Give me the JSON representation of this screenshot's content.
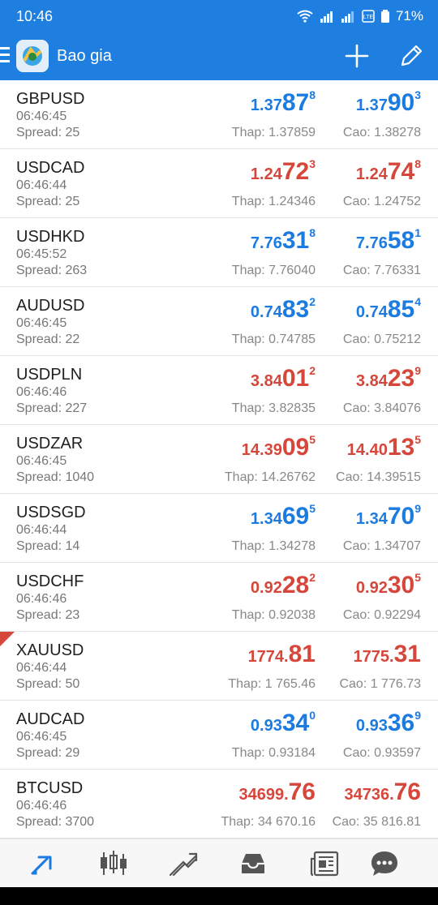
{
  "status": {
    "time": "10:46",
    "battery": "71%"
  },
  "app": {
    "title": "Bao gia",
    "accent": "#1f7fe0",
    "up_color": "#1b7be0",
    "down_color": "#d6463a"
  },
  "quotes": [
    {
      "symbol": "GBPUSD",
      "time": "06:46:45",
      "spread": "Spread: 25",
      "color": "blue",
      "bid": [
        "1.37",
        "87",
        "8"
      ],
      "ask": [
        "1.37",
        "90",
        "3"
      ],
      "low": "Thap: 1.37859",
      "high": "Cao: 1.38278"
    },
    {
      "symbol": "USDCAD",
      "time": "06:46:44",
      "spread": "Spread: 25",
      "color": "red",
      "bid": [
        "1.24",
        "72",
        "3"
      ],
      "ask": [
        "1.24",
        "74",
        "8"
      ],
      "low": "Thap: 1.24346",
      "high": "Cao: 1.24752"
    },
    {
      "symbol": "USDHKD",
      "time": "06:45:52",
      "spread": "Spread: 263",
      "color": "blue",
      "bid": [
        "7.76",
        "31",
        "8"
      ],
      "ask": [
        "7.76",
        "58",
        "1"
      ],
      "low": "Thap: 7.76040",
      "high": "Cao: 7.76331"
    },
    {
      "symbol": "AUDUSD",
      "time": "06:46:45",
      "spread": "Spread: 22",
      "color": "blue",
      "bid": [
        "0.74",
        "83",
        "2"
      ],
      "ask": [
        "0.74",
        "85",
        "4"
      ],
      "low": "Thap: 0.74785",
      "high": "Cao: 0.75212"
    },
    {
      "symbol": "USDPLN",
      "time": "06:46:46",
      "spread": "Spread: 227",
      "color": "red",
      "bid": [
        "3.84",
        "01",
        "2"
      ],
      "ask": [
        "3.84",
        "23",
        "9"
      ],
      "low": "Thap: 3.82835",
      "high": "Cao: 3.84076"
    },
    {
      "symbol": "USDZAR",
      "time": "06:46:45",
      "spread": "Spread: 1040",
      "color": "red",
      "bid": [
        "14.39",
        "09",
        "5"
      ],
      "ask": [
        "14.40",
        "13",
        "5"
      ],
      "low": "Thap: 14.26762",
      "high": "Cao: 14.39515"
    },
    {
      "symbol": "USDSGD",
      "time": "06:46:44",
      "spread": "Spread: 14",
      "color": "blue",
      "bid": [
        "1.34",
        "69",
        "5"
      ],
      "ask": [
        "1.34",
        "70",
        "9"
      ],
      "low": "Thap: 1.34278",
      "high": "Cao: 1.34707"
    },
    {
      "symbol": "USDCHF",
      "time": "06:46:46",
      "spread": "Spread: 23",
      "color": "red",
      "bid": [
        "0.92",
        "28",
        "2"
      ],
      "ask": [
        "0.92",
        "30",
        "5"
      ],
      "low": "Thap: 0.92038",
      "high": "Cao: 0.92294"
    },
    {
      "symbol": "XAUUSD",
      "time": "06:46:44",
      "spread": "Spread: 50",
      "color": "red",
      "bid": [
        "1774.",
        "81",
        ""
      ],
      "ask": [
        "1775.",
        "31",
        ""
      ],
      "low": "Thap: 1 765.46",
      "high": "Cao: 1 776.73"
    },
    {
      "symbol": "AUDCAD",
      "time": "06:46:45",
      "spread": "Spread: 29",
      "color": "blue",
      "bid": [
        "0.93",
        "34",
        "0"
      ],
      "ask": [
        "0.93",
        "36",
        "9"
      ],
      "low": "Thap: 0.93184",
      "high": "Cao: 0.93597"
    },
    {
      "symbol": "BTCUSD",
      "time": "06:46:46",
      "spread": "Spread: 3700",
      "color": "red",
      "bid": [
        "34699.",
        "76",
        ""
      ],
      "ask": [
        "34736.",
        "76",
        ""
      ],
      "low": "Thap: 34 670.16",
      "high": "Cao: 35 816.81"
    }
  ],
  "nav": [
    "quotes-icon",
    "chart-icon",
    "trade-icon",
    "history-icon",
    "news-icon",
    "chat-icon"
  ]
}
